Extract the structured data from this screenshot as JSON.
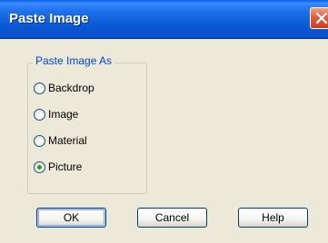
{
  "window": {
    "title": "Paste Image"
  },
  "group": {
    "label": "Paste Image As"
  },
  "options": [
    {
      "label": "Backdrop",
      "selected": false
    },
    {
      "label": "Image",
      "selected": false
    },
    {
      "label": "Material",
      "selected": false
    },
    {
      "label": "Picture",
      "selected": true
    }
  ],
  "buttons": {
    "ok": "OK",
    "cancel": "Cancel",
    "help": "Help"
  },
  "colors": {
    "title_bar": "#0a58d6",
    "group_label": "#0046d5",
    "close_button": "#e0603e",
    "radio_selected": "#21a121"
  }
}
